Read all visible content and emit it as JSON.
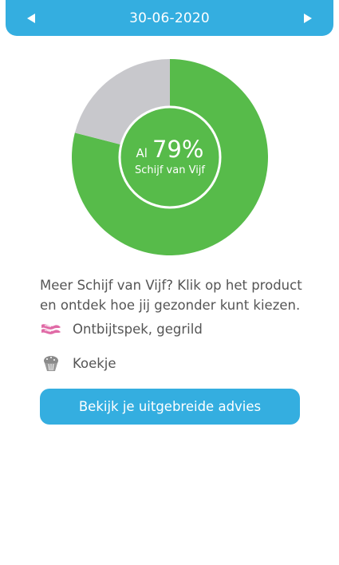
{
  "header": {
    "date": "30-06-2020",
    "prev_icon": "triangle-left-icon",
    "next_icon": "triangle-right-icon"
  },
  "colors": {
    "primary": "#34aee0",
    "in_schijf": "#57bb4a",
    "outside": "#c8c8cc",
    "text": "#555555"
  },
  "chart_data": {
    "type": "pie",
    "style": "donut-with-center-disc",
    "slices": [
      {
        "label": "Schijf van Vijf",
        "value": 79,
        "color": "#57bb4a"
      },
      {
        "label": "",
        "value": 21,
        "color": "#c8c8cc"
      }
    ],
    "center": {
      "prefix": "Al",
      "value": "79%",
      "caption": "Schijf van Vijf"
    }
  },
  "intro": {
    "text": "Meer Schijf van Vijf? Klik op het product en ontdek hoe jij gezonder kunt kiezen."
  },
  "products": [
    {
      "label": "Ontbijtspek, gegrild",
      "icon": "bacon-icon"
    },
    {
      "label": "Koekje",
      "icon": "cupcake-icon"
    }
  ],
  "cta": {
    "label": "Bekijk je uitgebreide advies"
  }
}
